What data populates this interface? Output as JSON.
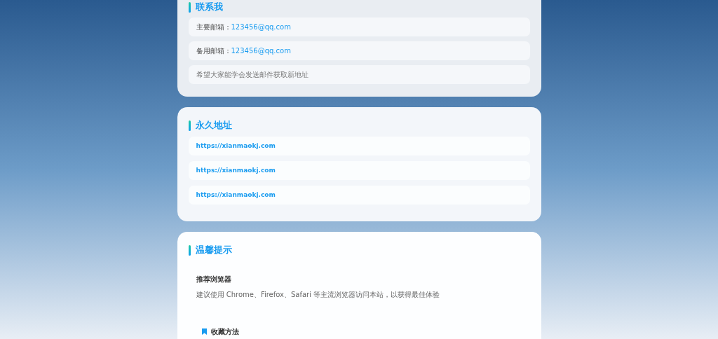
{
  "contact": {
    "title": "联系我",
    "rows": [
      {
        "kind": "email",
        "label": "主要邮箱：",
        "value": "123456@qq.com"
      },
      {
        "kind": "email",
        "label": "备用邮箱：",
        "value": "123456@qq.com"
      },
      {
        "kind": "note",
        "text": "希望大家能学会发送邮件获取新地址"
      }
    ]
  },
  "permanent": {
    "title": "永久地址",
    "links": [
      "https://xianmaokj.com",
      "https://xianmaokj.com",
      "https://xianmaokj.com"
    ]
  },
  "tips": {
    "title": "温馨提示",
    "heading": "推荐浏览器",
    "text": "建议使用 Chrome、Firefox、Safari 等主流浏览器访问本站，以获得最佳体验",
    "subheading": "收藏方法"
  }
}
